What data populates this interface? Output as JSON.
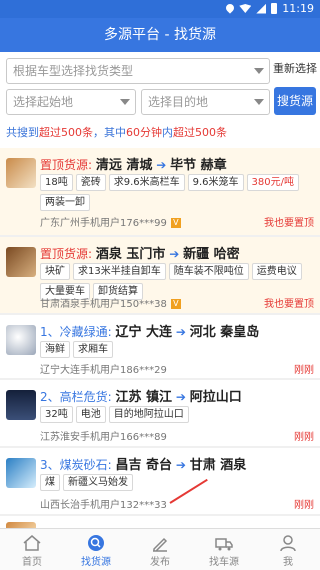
{
  "status": {
    "time": "11:19"
  },
  "header": {
    "title": "多源平台 - 找货源"
  },
  "search": {
    "cargo_placeholder": "根据车型选择找货类型",
    "reset_label": "重新选择",
    "origin_placeholder": "选择起始地",
    "dest_placeholder": "选择目的地",
    "search_label": "搜货源"
  },
  "summary": {
    "p1": "共搜到",
    "n1": "超过500条",
    "p2": "，其中",
    "n2": "60分钟",
    "p3": "内",
    "n3": "超过500条"
  },
  "listings": [
    {
      "tag": "置顶货源:",
      "from": "清远 清城",
      "arrow": "➔",
      "to": "毕节 赫章",
      "chips": [
        "18吨",
        "瓷砖",
        "求9.6米高栏车",
        "9.6米笼车",
        "380元/吨",
        "两装一卸"
      ],
      "meta": "广东广州手机用户176***99",
      "right": "我也要置顶"
    },
    {
      "tag": "置顶货源:",
      "from": "酒泉 玉门市",
      "arrow": "➔",
      "to": "新疆 哈密",
      "chips": [
        "块矿",
        "求13米半挂自卸车",
        "随车装不限吨位",
        "运费电议",
        "大量要车",
        "卸货结算"
      ],
      "meta": "甘肃酒泉手机用户150***38",
      "right": "我也要置顶"
    },
    {
      "tag": "1、冷藏绿通:",
      "from": "辽宁 大连",
      "arrow": "➔",
      "to": "河北 秦皇岛",
      "chips": [
        "海鲜",
        "求厢车"
      ],
      "meta": "辽宁大连手机用户186***29",
      "right": "刚刚"
    },
    {
      "tag": "2、高栏危货:",
      "from": "江苏 镇江",
      "arrow": "➔",
      "to": "阿拉山口",
      "chips": [
        "32吨",
        "电池",
        "目的地阿拉山口"
      ],
      "meta": "江苏淮安手机用户166***89",
      "right": "刚刚"
    },
    {
      "tag": "3、煤炭砂石:",
      "from": "昌吉 奇台",
      "arrow": "➔",
      "to": "甘肃 酒泉",
      "chips": [
        "煤",
        "新疆义马始发"
      ],
      "meta": "山西长治手机用户132***33",
      "right": "刚刚"
    }
  ],
  "tabs": [
    {
      "label": "首页",
      "icon": "home-icon"
    },
    {
      "label": "找货源",
      "icon": "find-cargo-icon"
    },
    {
      "label": "发布",
      "icon": "publish-icon"
    },
    {
      "label": "找车源",
      "icon": "truck-icon"
    },
    {
      "label": "我",
      "icon": "user-icon"
    }
  ],
  "colors": {
    "primary": "#3776e0",
    "accent_red": "#e53935",
    "top_bg": "#fff8ea"
  }
}
